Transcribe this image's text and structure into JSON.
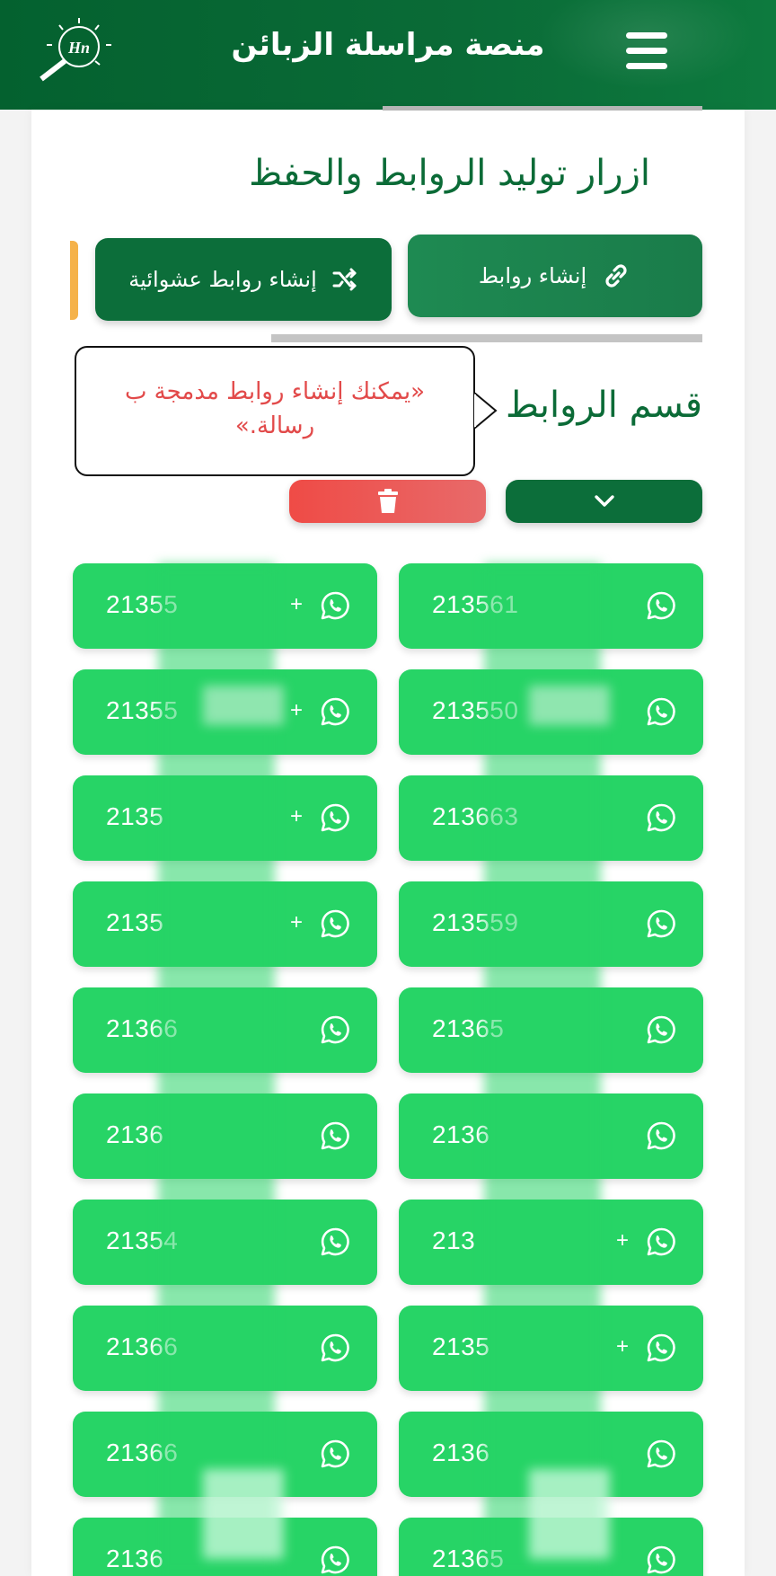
{
  "header": {
    "title": "منصة مراسلة الزبائن",
    "logo_icon": "magnifier-logo-icon",
    "menu_icon": "hamburger-menu-icon"
  },
  "generate_section": {
    "title": "ازرار توليد الروابط والحفظ",
    "create_links_label": "إنشاء روابط",
    "create_links_icon": "link-icon",
    "random_links_label": "إنشاء روابط عشوائية",
    "random_links_icon": "shuffle-icon"
  },
  "links_section": {
    "title": "قسم الروابط",
    "tooltip": "«يمكنك إنشاء روابط مدمجة ب رسالة.»",
    "toggle_icon": "chevron-down-icon",
    "delete_icon": "trash-icon"
  },
  "colors": {
    "header": "#04612f",
    "accent_green": "#0c6e3a",
    "whatsapp_green": "#27d466",
    "delete_red": "#ef4b46",
    "tooltip_text": "#e24a4a"
  },
  "numbers": [
    {
      "left": "21355",
      "right": "213561",
      "left_plus": "+",
      "right_plus": ""
    },
    {
      "left": "21355",
      "right": "213550",
      "left_plus": "+",
      "right_plus": ""
    },
    {
      "left": "2135",
      "right": "213663",
      "left_plus": "+",
      "right_plus": ""
    },
    {
      "left": "2135",
      "right": "213559",
      "left_plus": "+",
      "right_plus": ""
    },
    {
      "left": "21366",
      "right": "21365",
      "left_plus": "",
      "right_plus": ""
    },
    {
      "left": "2136",
      "right": "2136",
      "left_plus": "",
      "right_plus": ""
    },
    {
      "left": "21354",
      "right": "213",
      "left_plus": "",
      "right_plus": "+"
    },
    {
      "left": "21366",
      "right": "2135",
      "left_plus": "",
      "right_plus": "+"
    },
    {
      "left": "21366",
      "right": "2136",
      "left_plus": "",
      "right_plus": ""
    },
    {
      "left": "2136",
      "right": "21365",
      "left_plus": "",
      "right_plus": ""
    }
  ]
}
